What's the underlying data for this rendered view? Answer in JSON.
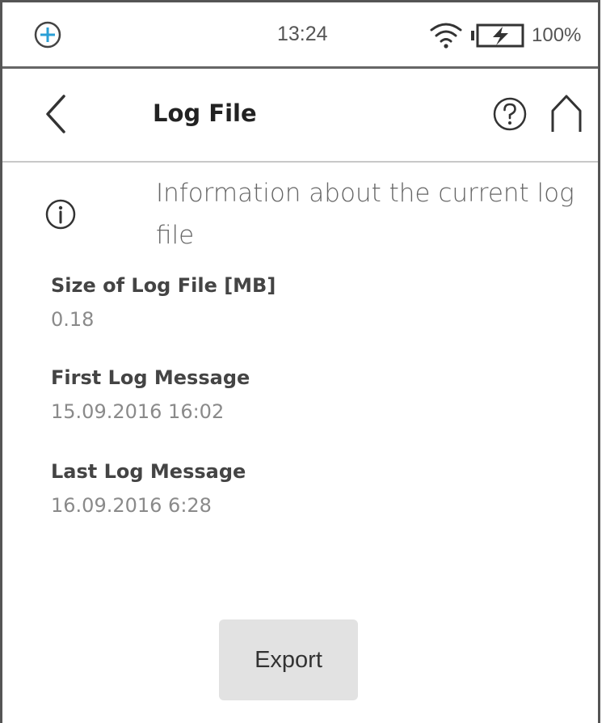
{
  "status_bar": {
    "time": "13:24",
    "battery_percent": "100%",
    "battery_level": 1.0,
    "logo_icon": "plus-circle-icon",
    "wifi_icon": "wifi-icon",
    "battery_icon": "battery-charging-icon",
    "logo_color": "#2a9fd6"
  },
  "header": {
    "title": "Log File",
    "back_icon": "chevron-left-icon",
    "help_icon": "help-icon",
    "home_icon": "home-icon"
  },
  "info": {
    "icon": "info-icon",
    "text": "Information about the current log file"
  },
  "fields": [
    {
      "label": "Size of Log File [MB]",
      "value": "0.18"
    },
    {
      "label": "First Log Message",
      "value": "15.09.2016 16:02"
    },
    {
      "label": "Last Log Message",
      "value": "16.09.2016 6:28"
    }
  ],
  "actions": {
    "export_label": "Export"
  }
}
